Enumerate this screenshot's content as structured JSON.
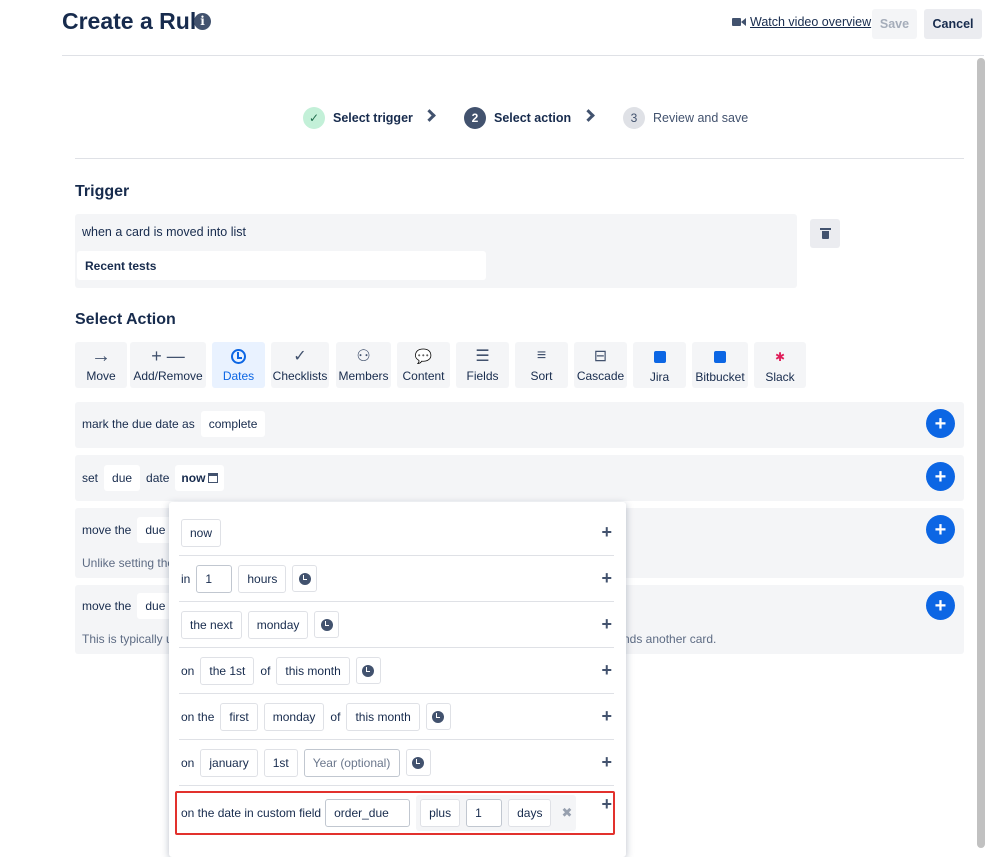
{
  "header": {
    "title": "Create a Rule",
    "info_glyph": "i",
    "video_link": "Watch video overview",
    "save": "Save",
    "cancel": "Cancel"
  },
  "stepper": {
    "steps": [
      {
        "num": "✓",
        "label": "Select trigger",
        "state": "done"
      },
      {
        "num": "2",
        "label": "Select action",
        "state": "current"
      },
      {
        "num": "3",
        "label": "Review and save",
        "state": "pending"
      }
    ]
  },
  "trigger": {
    "title": "Trigger",
    "text": "when a card is moved into list",
    "list": "Recent tests"
  },
  "action": {
    "title": "Select Action",
    "tabs": [
      {
        "label": "Move",
        "glyph": "→",
        "icon": "arrow-right-icon"
      },
      {
        "label": "Add/Remove",
        "glyph": "+ —",
        "icon": "plus-minus-icon"
      },
      {
        "label": "Dates",
        "glyph": "",
        "icon": "clock-icon",
        "active": true
      },
      {
        "label": "Checklists",
        "glyph": "✓",
        "icon": "check-icon"
      },
      {
        "label": "Members",
        "glyph": "⚇",
        "icon": "person-icon"
      },
      {
        "label": "Content",
        "glyph": "💬",
        "icon": "speech-bubble-icon"
      },
      {
        "label": "Fields",
        "glyph": "☰",
        "icon": "lines-icon"
      },
      {
        "label": "Sort",
        "glyph": "≡",
        "icon": "sort-icon"
      },
      {
        "label": "Cascade",
        "glyph": "⊟",
        "icon": "cascade-icon"
      },
      {
        "label": "Jira",
        "glyph": "",
        "icon": "jira-icon"
      },
      {
        "label": "Bitbucket",
        "glyph": "",
        "icon": "bitbucket-icon"
      },
      {
        "label": "Slack",
        "glyph": "✱",
        "icon": "slack-icon"
      }
    ],
    "rows": {
      "r1": {
        "prefix": "mark the due date as",
        "value": "complete"
      },
      "r2": {
        "set": "set",
        "field": "due",
        "date": "date",
        "when": "now"
      },
      "r3": {
        "prefix": "move the",
        "field": "due",
        "note": "Unlike setting the"
      },
      "r4": {
        "prefix": "move the",
        "field": "due",
        "note_left": "This is typically u",
        "note_right": "nds another card."
      }
    },
    "plus": "+"
  },
  "popover": {
    "add": "+",
    "rows": {
      "now": {
        "label": "now"
      },
      "in": {
        "prefix": "in",
        "amount": "1",
        "unit": "hours"
      },
      "next": {
        "a": "the next",
        "b": "monday"
      },
      "on1": {
        "prefix": "on",
        "a": "the 1st",
        "of": "of",
        "b": "this month"
      },
      "onthe": {
        "prefix": "on the",
        "a": "first",
        "b": "monday",
        "of": "of",
        "c": "this month"
      },
      "ondate": {
        "prefix": "on",
        "a": "january",
        "b": "1st",
        "year_placeholder": "Year (optional)"
      },
      "custom": {
        "prefix": "on the date in custom field",
        "field": "order_due",
        "plus": "plus",
        "amount": "1",
        "unit": "days",
        "remove": "✖"
      }
    }
  }
}
